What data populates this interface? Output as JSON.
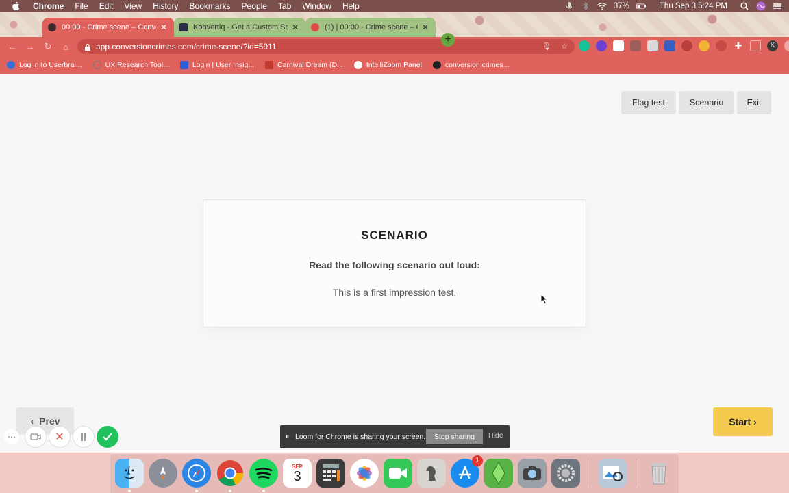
{
  "menubar": {
    "app": "Chrome",
    "items": [
      "File",
      "Edit",
      "View",
      "History",
      "Bookmarks",
      "People",
      "Tab",
      "Window",
      "Help"
    ],
    "battery": "37%",
    "datetime": "Thu Sep 3  5:24 PM"
  },
  "tabs": [
    {
      "title": "00:00 - Crime scene – Conver",
      "active": true
    },
    {
      "title": "Konvertiq - Get a Custom Sale",
      "active": false
    },
    {
      "title": "(1) | 00:00 - Crime scene – Co",
      "active": false
    }
  ],
  "toolbar": {
    "url": "app.conversioncrimes.com/crime-scene/?id=5911",
    "profile_initial": "K"
  },
  "bookmarks": [
    {
      "label": "Log in to Userbrai...",
      "color": "#3a6fd8"
    },
    {
      "label": "UX Research Tool...",
      "color": "#8a8a8a"
    },
    {
      "label": "Login | User Insig...",
      "color": "#2f5bd3"
    },
    {
      "label": "Carnival Dream (D...",
      "color": "#c0392b"
    },
    {
      "label": "IntelliZoom Panel",
      "color": "#ffffff"
    },
    {
      "label": "conversion crimes...",
      "color": "#222222"
    }
  ],
  "page": {
    "flag_label": "Flag test",
    "scenario_label": "Scenario",
    "exit_label": "Exit",
    "card_title": "SCENARIO",
    "card_subtitle": "Read the following scenario out loud:",
    "card_body": "This is a first impression test.",
    "prev_label": "Prev",
    "start_label": "Start"
  },
  "loom": {
    "message": "Loom for Chrome is sharing your screen.",
    "stop_label": "Stop sharing",
    "hide_label": "Hide"
  },
  "dock": {
    "calendar_month": "SEP",
    "calendar_day": "3",
    "appstore_badge": "1"
  },
  "colors": {
    "accent_red": "#e0625d",
    "start_yellow": "#f5cb4f",
    "loom_green": "#21c25e"
  }
}
